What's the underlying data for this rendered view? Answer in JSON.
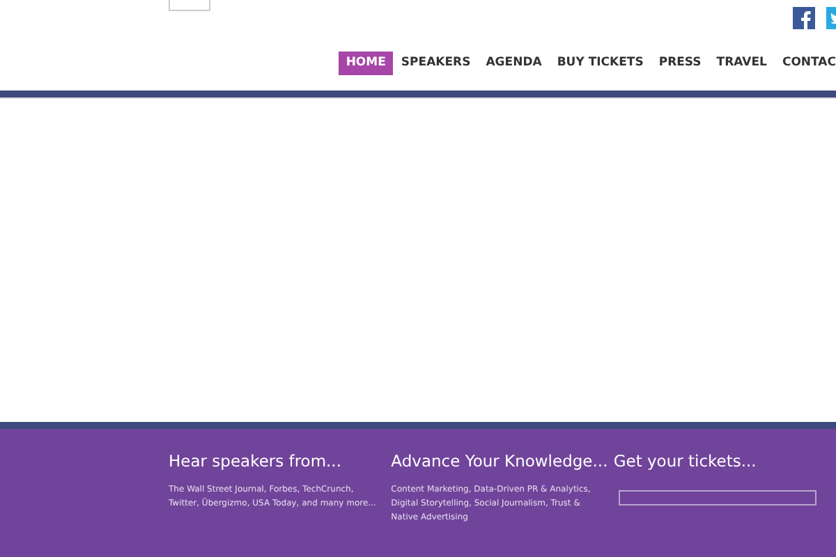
{
  "nav": [
    {
      "label": "HOME",
      "selected": true
    },
    {
      "label": "SPEAKERS",
      "selected": false
    },
    {
      "label": "AGENDA",
      "selected": false
    },
    {
      "label": "BUY TICKETS",
      "selected": false
    },
    {
      "label": "PRESS",
      "selected": false
    },
    {
      "label": "TRAVEL",
      "selected": false
    },
    {
      "label": "CONTAC",
      "selected": false
    }
  ],
  "footer": [
    {
      "kind": "text",
      "heading": "Hear speakers from...",
      "body": "The Wall Street Journal, Forbes, TechCrunch, Twitter, Übergizmo, USA Today, and many more..."
    },
    {
      "kind": "text",
      "heading": "Advance Your Knowledge...",
      "body": "Content Marketing, Data-Driven PR & Analytics, Digital Storytelling, Social Journalism, Trust & Native Advertising"
    },
    {
      "kind": "field",
      "heading": "Get your tickets..."
    }
  ]
}
